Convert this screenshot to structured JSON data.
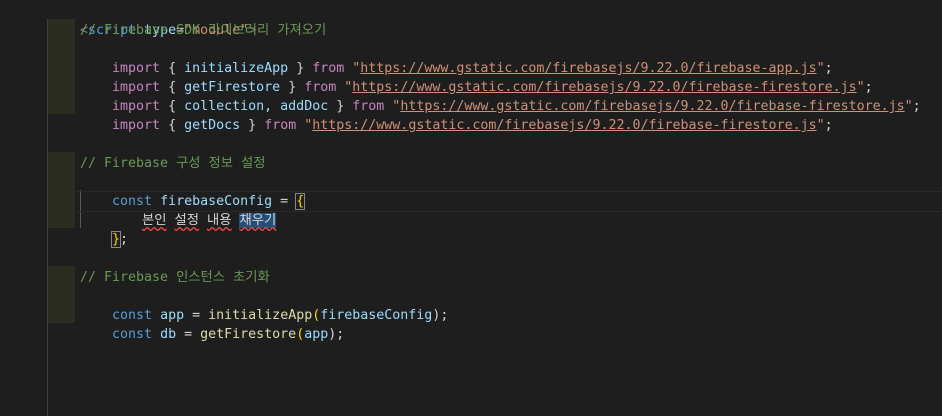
{
  "script_open": {
    "tag_open": "<",
    "tag_name": "script",
    "attr_name": "type",
    "eq": "=",
    "attr_value": "\"module\"",
    "tag_close": ">"
  },
  "comment_sdk": "// Firebase SDK 라이브러리 가져오기",
  "imports": [
    {
      "kw": "import",
      "open": " { ",
      "names": "initializeApp",
      "close": " } ",
      "from": "from",
      "url": "https://www.gstatic.com/firebasejs/9.22.0/firebase-app.js",
      "end": ";"
    },
    {
      "kw": "import",
      "open": " { ",
      "names": "getFirestore",
      "close": " } ",
      "from": "from",
      "url": "https://www.gstatic.com/firebasejs/9.22.0/firebase-firestore.js",
      "end": ";"
    },
    {
      "kw": "import",
      "open": " { ",
      "names": "collection, addDoc",
      "close": " } ",
      "from": "from",
      "url": "https://www.gstatic.com/firebasejs/9.22.0/firebase-firestore.js",
      "end": ";"
    },
    {
      "kw": "import",
      "open": " { ",
      "names": "getDocs",
      "close": " } ",
      "from": "from",
      "url": "https://www.gstatic.com/firebasejs/9.22.0/firebase-firestore.js",
      "end": ";"
    }
  ],
  "comment_config": "// Firebase 구성 정보 설정",
  "config": {
    "kw": "const",
    "name": "firebaseConfig",
    "eq": " = ",
    "open": "{",
    "body_a": "본인",
    "body_b": "설정",
    "body_c": "내용",
    "body_d": "채우기",
    "close": "}",
    "end": ";"
  },
  "comment_init": "// Firebase 인스턴스 초기화",
  "app_line": {
    "kw": "const",
    "name": "app",
    "eq": " = ",
    "fn": "initializeApp",
    "arg": "firebaseConfig",
    "end": ");"
  },
  "db_line": {
    "kw": "const",
    "name": "db",
    "eq": " = ",
    "fn": "getFirestore",
    "arg": "app",
    "end": ");"
  }
}
